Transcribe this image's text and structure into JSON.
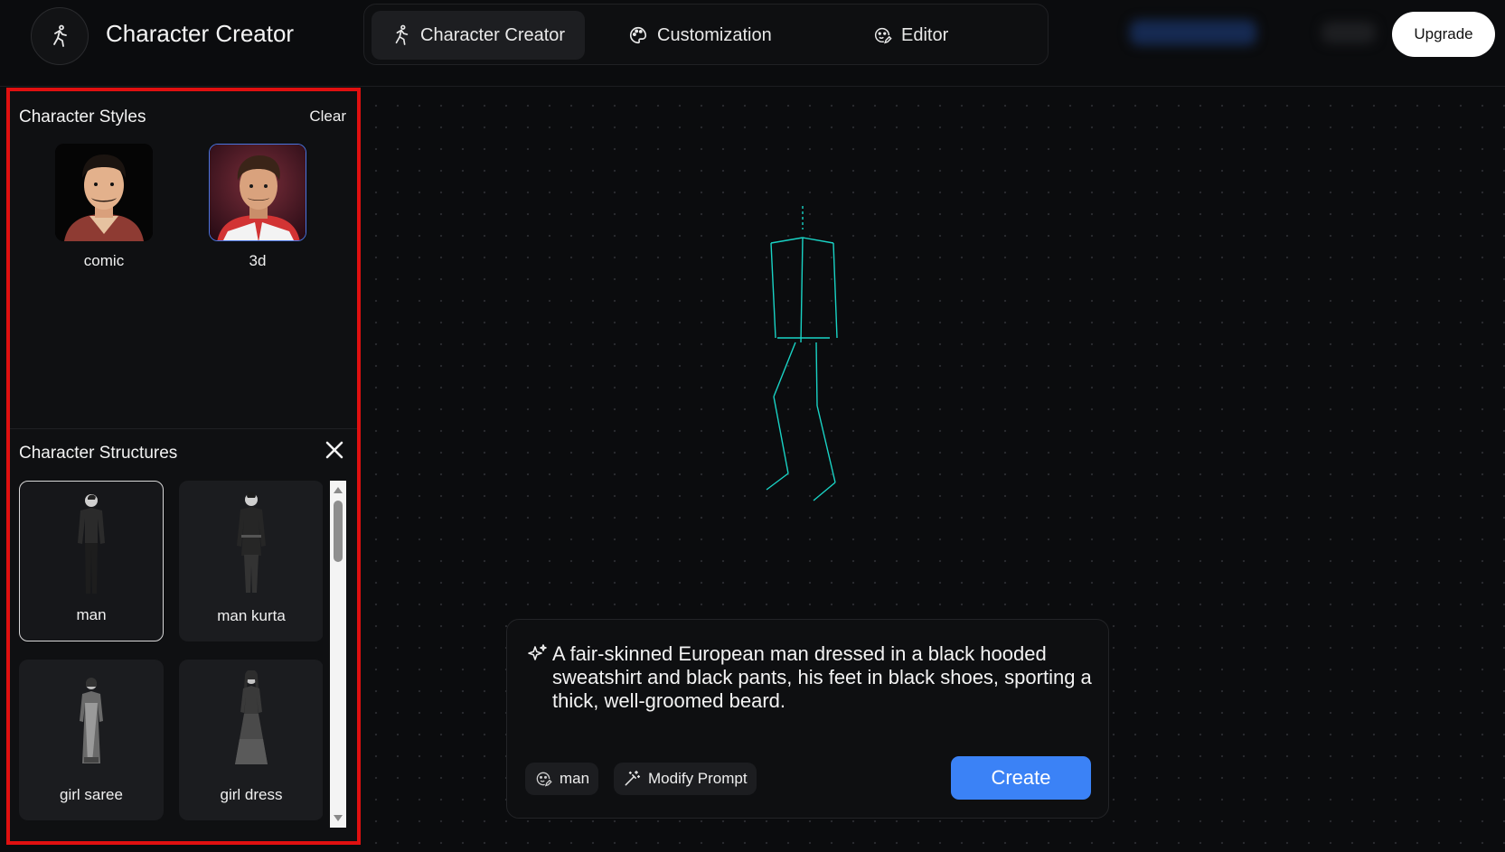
{
  "header": {
    "title": "Character Creator",
    "logo_icon": "running-figure-icon",
    "tabs": [
      {
        "label": "Character Creator",
        "icon": "running-figure-icon",
        "active": true
      },
      {
        "label": "Customization",
        "icon": "palette-icon",
        "active": false
      },
      {
        "label": "Editor",
        "icon": "face-edit-icon",
        "active": false
      }
    ],
    "upgrade_label": "Upgrade"
  },
  "styles_panel": {
    "title": "Character Styles",
    "clear_label": "Clear",
    "items": [
      {
        "label": "comic",
        "selected": false
      },
      {
        "label": "3d",
        "selected": true
      }
    ]
  },
  "structures_panel": {
    "title": "Character Structures",
    "close_icon": "close-icon",
    "items": [
      {
        "label": "man",
        "selected": true
      },
      {
        "label": "man kurta",
        "selected": false
      },
      {
        "label": "girl saree",
        "selected": false
      },
      {
        "label": "girl dress",
        "selected": false
      }
    ]
  },
  "prompt": {
    "text": "A fair-skinned European man dressed in a black hooded sweatshirt and black pants, his feet in black shoes, sporting a thick, well-groomed beard.",
    "chip_structure": "man",
    "chip_modify": "Modify Prompt",
    "create_label": "Create"
  },
  "colors": {
    "accent_blue": "#3b82f6",
    "highlight_red": "#e01010",
    "skeleton_cyan": "#19d3c5"
  }
}
